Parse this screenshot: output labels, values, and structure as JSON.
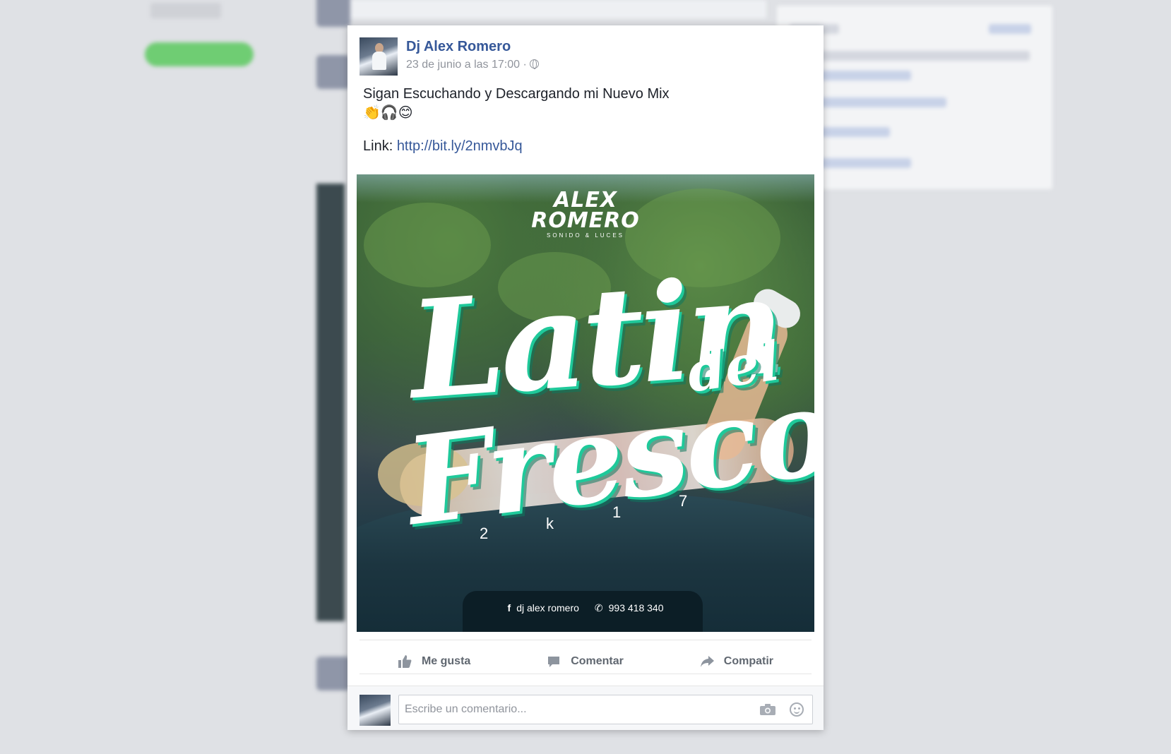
{
  "post": {
    "author": "Dj Alex Romero",
    "timestamp": "23 de junio a las 17:00 ·",
    "text": "Sigan Escuchando y Descargando mi Nuevo Mix",
    "emojis": "👏🎧😊",
    "link_label": "Link: ",
    "link_url": "http://bit.ly/2nmvbJq",
    "cover": {
      "logo_line1": "ALEX",
      "logo_line2": "ROMERO",
      "logo_sub": "SONIDO & LUCES",
      "title_latin": "Latin",
      "title_del": "del",
      "title_fresco": "Fresco",
      "year": [
        "2",
        "k",
        "1",
        "7"
      ],
      "footer_fb_icon": "f",
      "footer_name": "dj alex romero",
      "footer_phone_icon": "✆",
      "footer_phone": "993 418 340"
    }
  },
  "actions": {
    "like": "Me gusta",
    "comment": "Comentar",
    "share": "Compatir"
  },
  "comment_box": {
    "placeholder": "Escribe un comentario..."
  },
  "colors": {
    "link": "#365899",
    "accent_teal": "#1fc99a",
    "background": "#dfe1e5"
  },
  "icons": [
    "globe-icon",
    "like-icon",
    "comment-icon",
    "share-icon",
    "camera-icon",
    "smile-icon"
  ]
}
